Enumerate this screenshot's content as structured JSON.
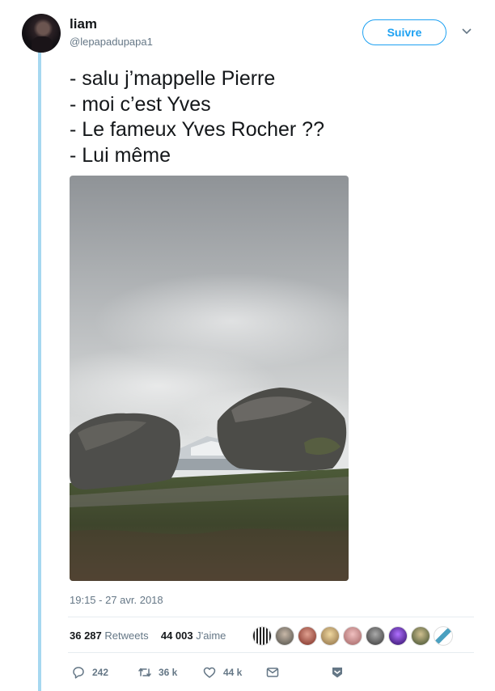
{
  "user": {
    "name": "liam",
    "handle": "@lepapadupapa1"
  },
  "follow_button": "Suivre",
  "tweet_lines": [
    "- salu j’mappelle Pierre",
    "- moi c’est Yves",
    "- Le fameux Yves Rocher ??",
    "- Lui même"
  ],
  "timestamp": "19:15 - 27 avr. 2018",
  "stats": {
    "retweets_count": "36 287",
    "retweets_label": "Retweets",
    "likes_count": "44 003",
    "likes_label": "J'aime"
  },
  "actions": {
    "replies": "242",
    "retweets": "36 k",
    "likes": "44 k"
  },
  "colors": {
    "accent": "#1da1f2",
    "thread_line": "#a6d8f0",
    "secondary_text": "#657786"
  },
  "icons": [
    "chevron-down-icon",
    "reply-icon",
    "retweet-icon",
    "heart-icon",
    "envelope-icon",
    "save-icon"
  ]
}
